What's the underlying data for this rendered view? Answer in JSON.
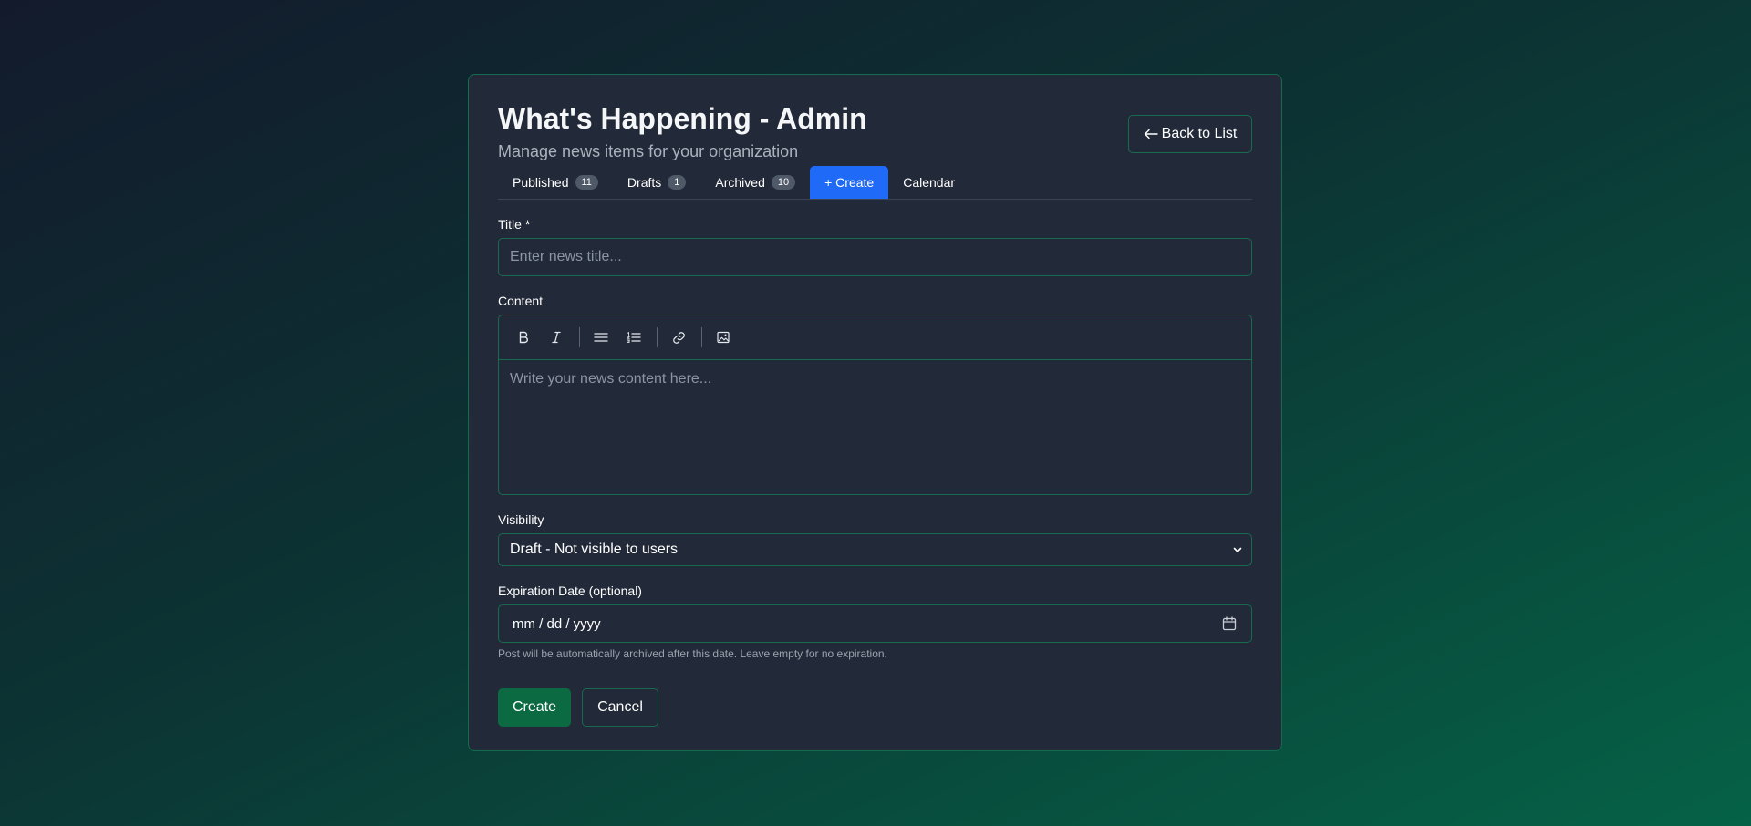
{
  "header": {
    "title": "What's Happening - Admin",
    "subtitle": "Manage news items for your organization",
    "back_label": "Back to List"
  },
  "tabs": [
    {
      "label": "Published",
      "count": "11",
      "active": false
    },
    {
      "label": "Drafts",
      "count": "1",
      "active": false
    },
    {
      "label": "Archived",
      "count": "10",
      "active": false
    },
    {
      "label": "+ Create",
      "count": null,
      "active": true
    },
    {
      "label": "Calendar",
      "count": null,
      "active": false
    }
  ],
  "form": {
    "title_label": "Title *",
    "title_placeholder": "Enter news title...",
    "title_value": "",
    "content_label": "Content",
    "content_placeholder": "Write your news content here...",
    "toolbar_icons": [
      "bold-icon",
      "italic-icon",
      "bullet-list-icon",
      "numbered-list-icon",
      "link-icon",
      "image-icon"
    ],
    "visibility_label": "Visibility",
    "visibility_value": "Draft - Not visible to users",
    "expiration_label": "Expiration Date (optional)",
    "expiration_placeholder": "mm / dd / yyyy",
    "expiration_help": "Post will be automatically archived after this date. Leave empty for no expiration.",
    "create_label": "Create",
    "cancel_label": "Cancel"
  },
  "colors": {
    "accent_tab": "#1f6af6",
    "primary_button": "#0c6a43",
    "border_green": "#1a6a50",
    "card_bg": "#222938"
  }
}
